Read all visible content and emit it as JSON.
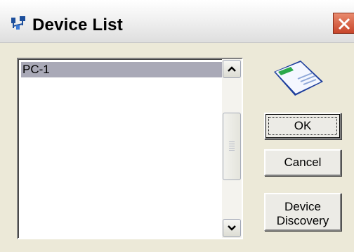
{
  "window": {
    "title": "Device List",
    "app_icon": "device-network-icon",
    "close_icon": "close-x-icon"
  },
  "device_list": {
    "items": [
      "PC-1"
    ],
    "selected_index": 0
  },
  "scrollbar": {
    "up_icon": "chevron-up-icon",
    "down_icon": "chevron-down-icon"
  },
  "decoration": {
    "card_icon": "network-card-icon"
  },
  "buttons": {
    "ok": "OK",
    "cancel": "Cancel",
    "discovery_line1": "Device",
    "discovery_line2": "Discovery"
  },
  "colors": {
    "selection": "#a9a9b7",
    "close_button": "#d9603f"
  }
}
